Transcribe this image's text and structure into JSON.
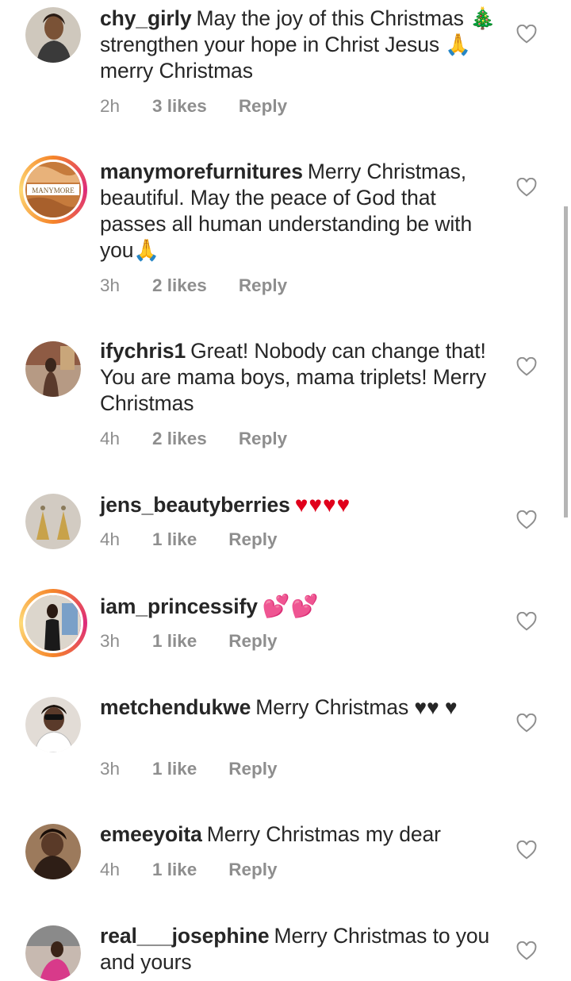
{
  "comments": [
    {
      "username": "chy_girly",
      "text": "May the joy of this Christmas 🎄 strengthen your hope in Christ Jesus 🙏merry Christmas",
      "time": "2h",
      "likes": "3 likes",
      "reply": "Reply",
      "avatar_icon": "avatar-photo",
      "avatar_color": "#c9c1b5"
    },
    {
      "username": "manymorefurnitures",
      "text": "Merry Christmas, beautiful. May the peace of God that passes all human understanding be with you🙏",
      "time": "3h",
      "likes": "2 likes",
      "reply": "Reply",
      "avatar_icon": "avatar-logo",
      "avatar_logo_text": "MANYMORE"
    },
    {
      "username": "ifychris1",
      "text": "Great! Nobody can change that! You are mama boys, mama triplets! Merry Christmas",
      "time": "4h",
      "likes": "2 likes",
      "reply": "Reply",
      "avatar_icon": "avatar-photo",
      "avatar_color": "#8a6a54"
    },
    {
      "username": "jens_beautyberries",
      "text": "♥♥♥♥",
      "time": "4h",
      "likes": "1 like",
      "reply": "Reply",
      "avatar_icon": "avatar-photo",
      "avatar_color": "#a89a88"
    },
    {
      "username": "iam_princessify",
      "text": "💕💕",
      "time": "3h",
      "likes": "1 like",
      "reply": "Reply",
      "avatar_icon": "avatar-photo",
      "avatar_color": "#d8d2c8"
    },
    {
      "username": "metchendukwe",
      "text": "Merry Christmas ♥♥ ♥",
      "time": "3h",
      "likes": "1 like",
      "reply": "Reply",
      "avatar_icon": "avatar-photo",
      "avatar_color": "#c7c1bd"
    },
    {
      "username": "emeeyoita",
      "text": "Merry Christmas my dear",
      "time": "4h",
      "likes": "1 like",
      "reply": "Reply",
      "avatar_icon": "avatar-photo",
      "avatar_color": "#6b4a38"
    },
    {
      "username": "real___josephine",
      "text": "Merry Christmas to you and yours",
      "time": "",
      "likes": "",
      "reply": "",
      "avatar_icon": "avatar-photo",
      "avatar_color": "#b9a39a"
    }
  ],
  "colors": {
    "username": "#262626",
    "meta": "#8e8e8e",
    "heart_emoji": "#e0001b",
    "story_ring_start": "#f58529",
    "story_ring_end": "#dd2a7b"
  }
}
